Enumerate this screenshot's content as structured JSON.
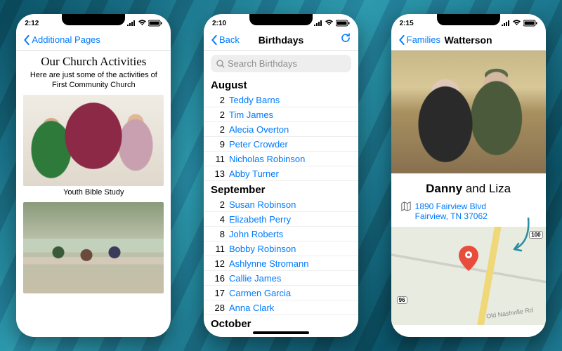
{
  "screen1": {
    "time": "2:12",
    "back_label": "Additional Pages",
    "title": "Our Church Activities",
    "subtitle": "Here are just some of the activities of First Community Church",
    "caption1": "Youth Bible Study"
  },
  "screen2": {
    "time": "2:10",
    "back_label": "Back",
    "title": "Birthdays",
    "search_placeholder": "Search Birthdays",
    "sections": [
      {
        "month": "August",
        "rows": [
          {
            "day": "2",
            "name": "Teddy Barns"
          },
          {
            "day": "2",
            "name": "Tim James"
          },
          {
            "day": "2",
            "name": "Alecia Overton"
          },
          {
            "day": "9",
            "name": "Peter Crowder"
          },
          {
            "day": "11",
            "name": "Nicholas Robinson"
          },
          {
            "day": "13",
            "name": "Abby Turner"
          }
        ]
      },
      {
        "month": "September",
        "rows": [
          {
            "day": "2",
            "name": "Susan Robinson"
          },
          {
            "day": "4",
            "name": "Elizabeth Perry"
          },
          {
            "day": "8",
            "name": "John Roberts"
          },
          {
            "day": "11",
            "name": "Bobby Robinson"
          },
          {
            "day": "12",
            "name": "Ashlynne Stromann"
          },
          {
            "day": "16",
            "name": "Callie James"
          },
          {
            "day": "17",
            "name": "Carmen Garcia"
          },
          {
            "day": "28",
            "name": "Anna Clark"
          }
        ]
      },
      {
        "month": "October",
        "rows": []
      }
    ]
  },
  "screen3": {
    "time": "2:15",
    "back_label": "Families",
    "title": "Watterson",
    "name1": "Danny",
    "conj": " and ",
    "name2": "Liza",
    "addr_line1": "1890 Fairview Blvd",
    "addr_line2": "Fairview, TN 37062",
    "road": "Old Nashville Rd",
    "shield1": "96",
    "shield2": "100"
  }
}
